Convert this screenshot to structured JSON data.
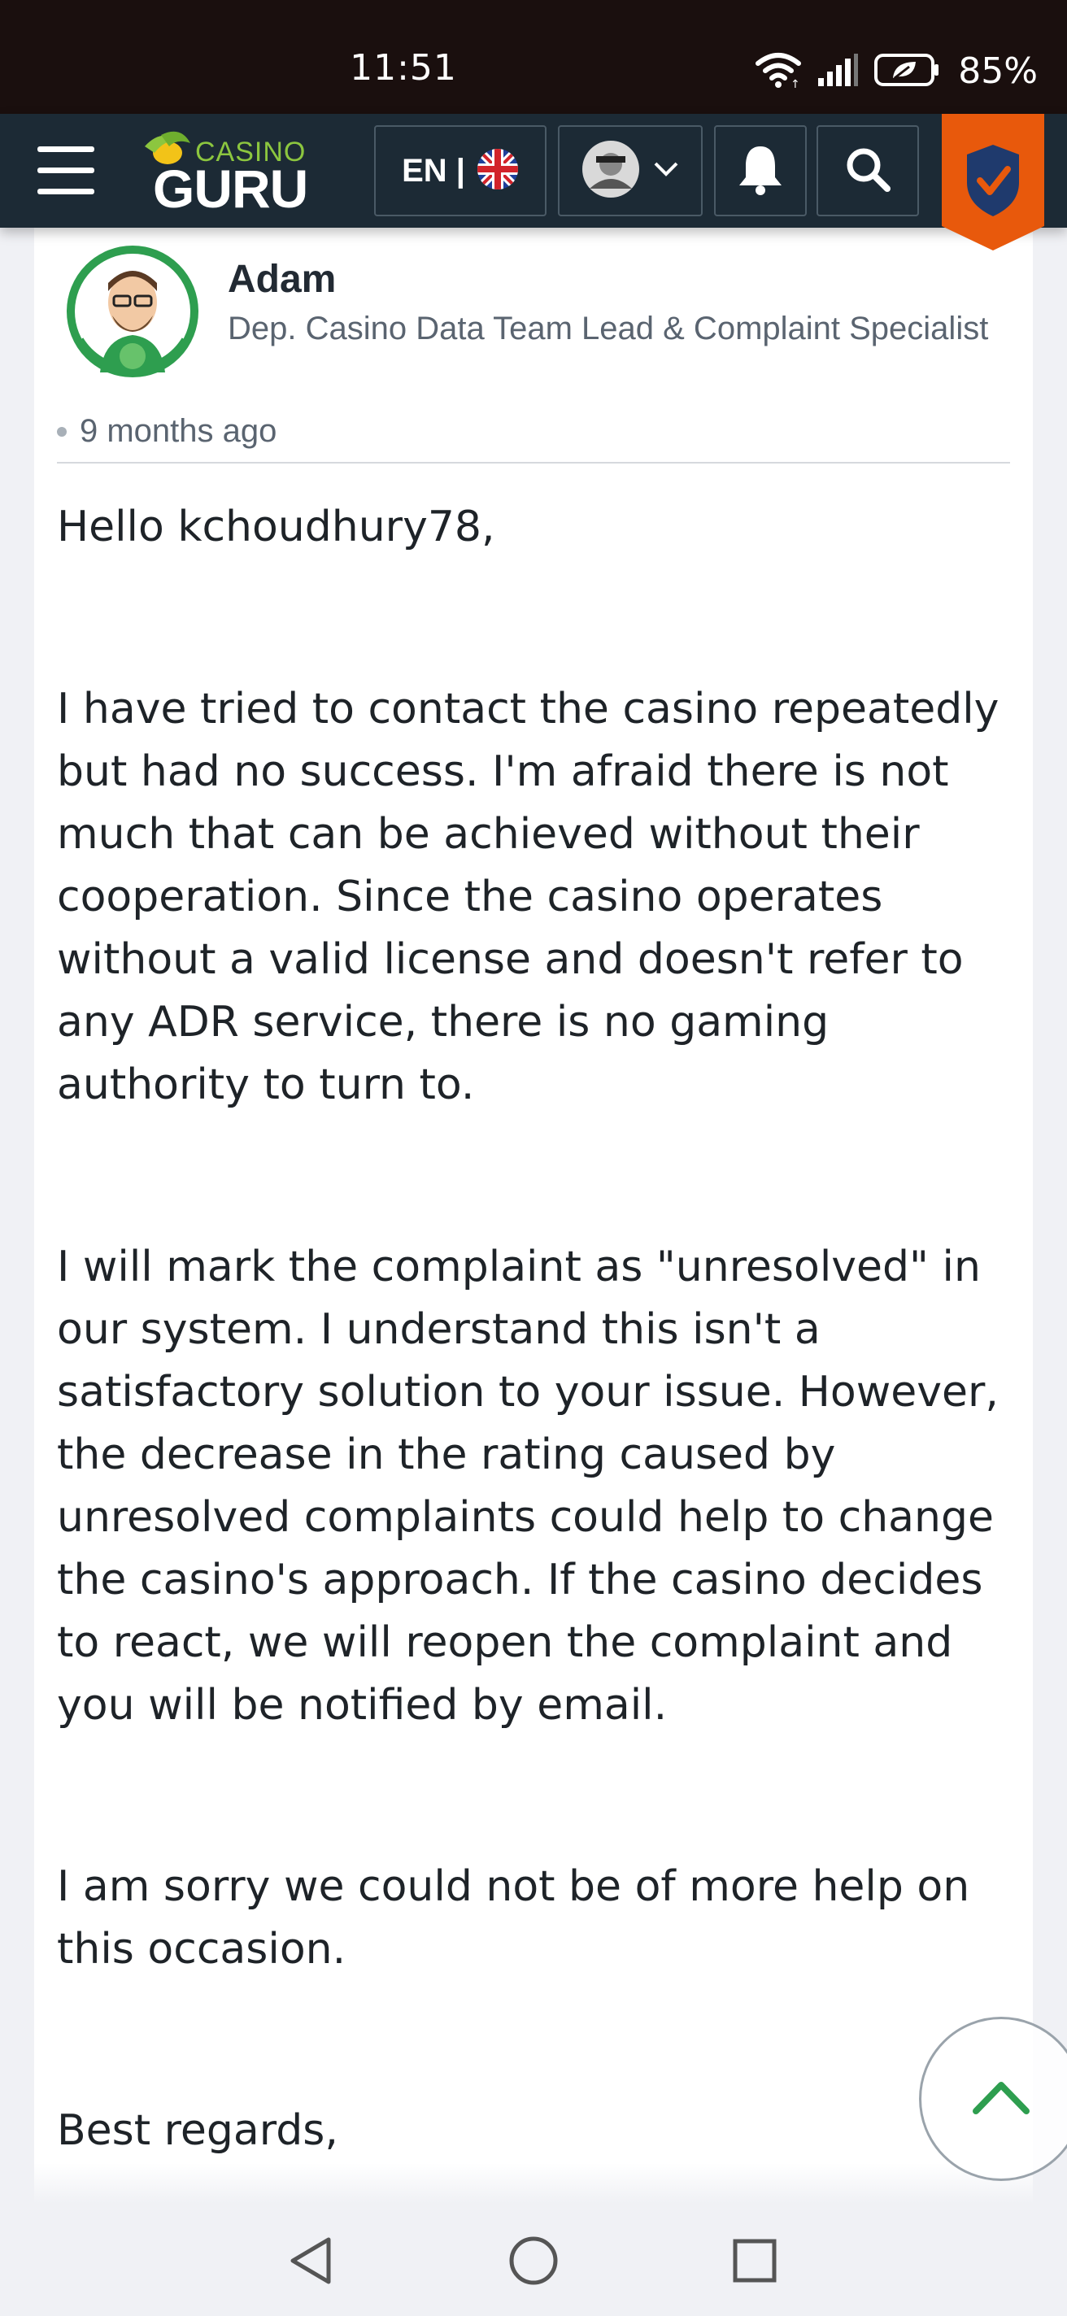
{
  "status_bar": {
    "time": "11:51",
    "battery": "85%",
    "icons": [
      "wifi-icon",
      "signal-icon",
      "battery-icon"
    ]
  },
  "header": {
    "logo_top": "CASINO",
    "logo_bottom": "GURU",
    "language": "EN |",
    "icons": [
      "menu-icon",
      "uk-flag-icon",
      "avatar-icon",
      "chevron-down-icon",
      "bell-icon",
      "search-icon",
      "shield-check-icon"
    ],
    "accent_color": "#e8590c",
    "bg_color": "#1c2a35"
  },
  "post": {
    "author_name": "Adam",
    "author_role": "Dep. Casino Data Team Lead & Complaint Specialist",
    "time_ago": "9 months ago",
    "greeting": "Hello kchoudhury78,",
    "paragraph_1": "I have tried to contact the casino repeatedly but had no success. I'm afraid there is not much that can be achieved without their cooperation. Since the casino operates without a valid license and doesn't refer to any ADR service, there is no gaming authority to turn to.",
    "paragraph_2": "I will mark the complaint as \"unresolved\" in our system. I understand this isn't a satisfactory solution to your issue. However, the decrease in the rating caused by unresolved complaints could help to change the casino's approach. If the casino decides to react, we will reopen the complaint and you will be notified by email.",
    "paragraph_3": "I am sorry we could not be of more help on this occasion.",
    "closing": "Best regards,"
  },
  "controls": {
    "scroll_top_icon": "chevron-up-icon",
    "scroll_top_color": "#2e9e4f"
  },
  "nav_bar": {
    "icons": [
      "back-icon",
      "home-icon",
      "recents-icon"
    ]
  }
}
